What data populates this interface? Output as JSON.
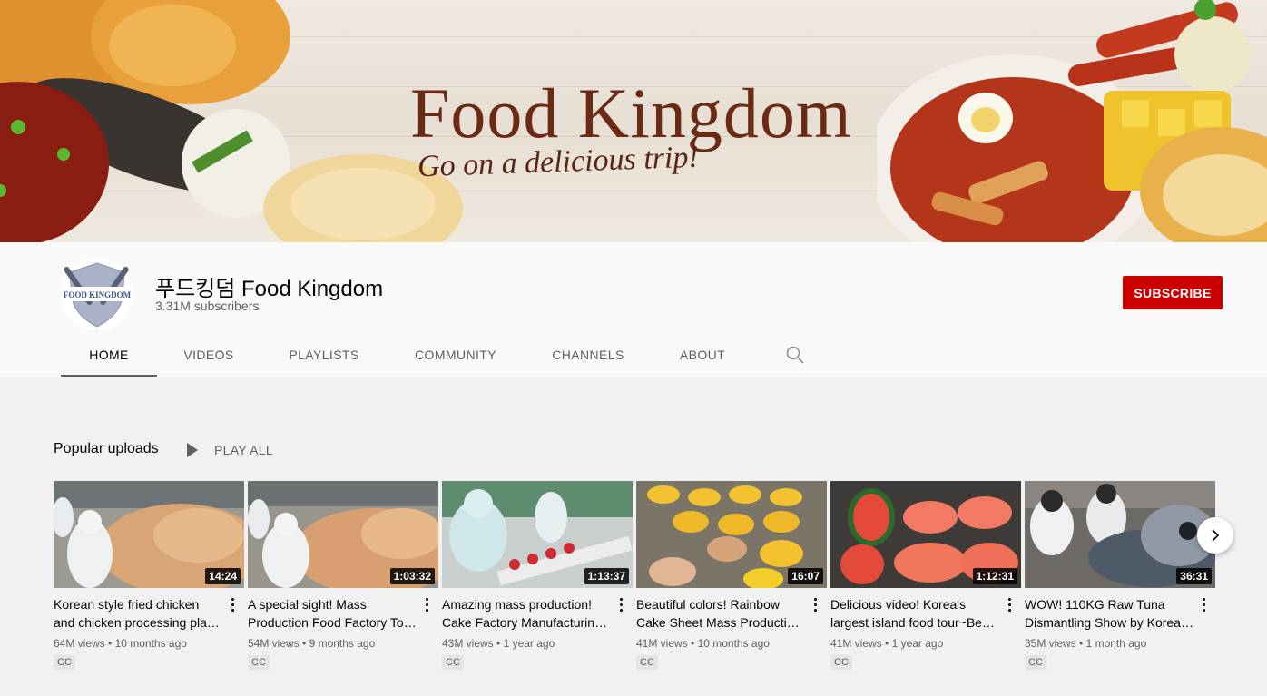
{
  "banner": {
    "title": "Food Kingdom",
    "subtitle": "Go on a delicious trip!"
  },
  "channel": {
    "avatar_text": "FOOD KINGDOM",
    "name": "푸드킹덤 Food Kingdom",
    "subscribers": "3.31M subscribers",
    "subscribe_label": "SUBSCRIBE"
  },
  "tabs": [
    {
      "label": "HOME",
      "active": true
    },
    {
      "label": "VIDEOS",
      "active": false
    },
    {
      "label": "PLAYLISTS",
      "active": false
    },
    {
      "label": "COMMUNITY",
      "active": false
    },
    {
      "label": "CHANNELS",
      "active": false
    },
    {
      "label": "ABOUT",
      "active": false
    }
  ],
  "shelf": {
    "title": "Popular uploads",
    "play_all": "PLAY ALL"
  },
  "videos": [
    {
      "line1": "Korean style fried chicken",
      "line2": "and chicken processing pla…",
      "duration": "14:24",
      "views": "64M views",
      "age": "10 months ago",
      "badge": "CC"
    },
    {
      "line1": "A special sight! Mass",
      "line2": "Production Food Factory To…",
      "duration": "1:03:32",
      "views": "54M views",
      "age": "9 months ago",
      "badge": "CC"
    },
    {
      "line1": "Amazing mass production!",
      "line2": "Cake Factory Manufacturin…",
      "duration": "1:13:37",
      "views": "43M views",
      "age": "1 year ago",
      "badge": "CC"
    },
    {
      "line1": "Beautiful colors! Rainbow",
      "line2": "Cake Sheet Mass Productio…",
      "duration": "16:07",
      "views": "41M views",
      "age": "10 months ago",
      "badge": "CC"
    },
    {
      "line1": "Delicious video! Korea's",
      "line2": "largest island food tour~Be…",
      "duration": "1:12:31",
      "views": "41M views",
      "age": "1 year ago",
      "badge": "CC"
    },
    {
      "line1": "WOW! 110KG Raw Tuna",
      "line2": "Dismantling Show by Korea'…",
      "duration": "36:31",
      "views": "35M views",
      "age": "1 month ago",
      "badge": "CC"
    }
  ],
  "colors": {
    "subscribe": "#cc0000",
    "banner_text": "#6a2a14",
    "meta_text": "#606060"
  }
}
